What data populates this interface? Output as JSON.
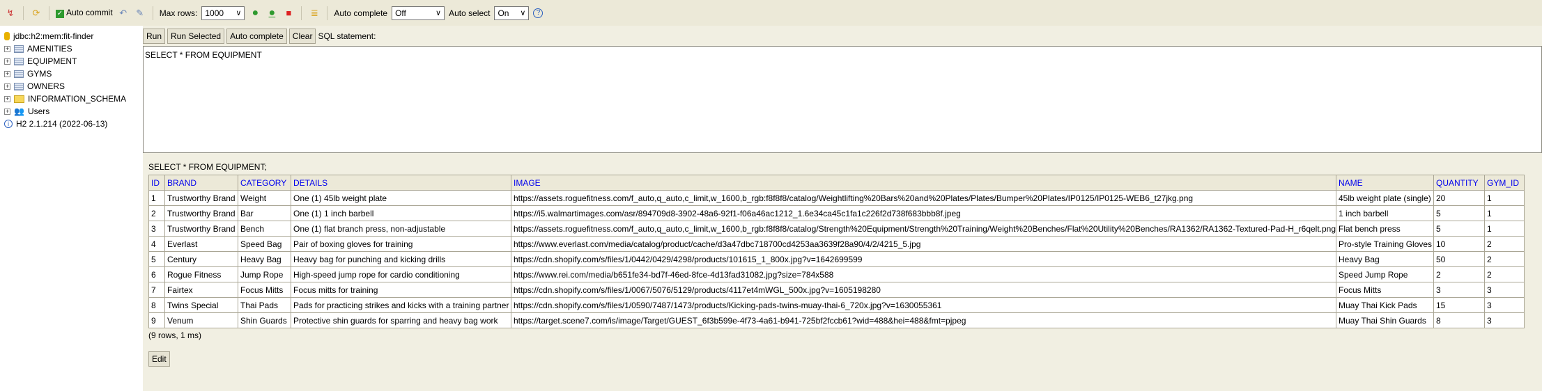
{
  "toolbar": {
    "auto_commit": "Auto commit",
    "max_rows_label": "Max rows:",
    "max_rows": "1000",
    "auto_complete_label": "Auto complete",
    "auto_complete": "Off",
    "auto_select_label": "Auto select",
    "auto_select": "On"
  },
  "sidebar": {
    "connection": "jdbc:h2:mem:fit-finder",
    "items": [
      {
        "label": "AMENITIES",
        "type": "table"
      },
      {
        "label": "EQUIPMENT",
        "type": "table"
      },
      {
        "label": "GYMS",
        "type": "table"
      },
      {
        "label": "OWNERS",
        "type": "table"
      },
      {
        "label": "INFORMATION_SCHEMA",
        "type": "folder"
      },
      {
        "label": "Users",
        "type": "users"
      }
    ],
    "version": "H2 2.1.214 (2022-06-13)"
  },
  "editor": {
    "run": "Run",
    "run_selected": "Run Selected",
    "auto_complete": "Auto complete",
    "clear": "Clear",
    "sql_label": "SQL statement:",
    "sql": "SELECT * FROM EQUIPMENT"
  },
  "results": {
    "query": "SELECT * FROM EQUIPMENT;",
    "columns": [
      "ID",
      "BRAND",
      "CATEGORY",
      "DETAILS",
      "IMAGE",
      "NAME",
      "QUANTITY",
      "GYM_ID"
    ],
    "rows": [
      [
        "1",
        "Trustworthy Brand",
        "Weight",
        "One (1) 45lb weight plate",
        "https://assets.roguefitness.com/f_auto,q_auto,c_limit,w_1600,b_rgb:f8f8f8/catalog/Weightlifting%20Bars%20and%20Plates/Plates/Bumper%20Plates/IP0125/IP0125-WEB6_t27jkg.png",
        "45lb weight plate (single)",
        "20",
        "1"
      ],
      [
        "2",
        "Trustworthy Brand",
        "Bar",
        "One (1) 1 inch barbell",
        "https://i5.walmartimages.com/asr/894709d8-3902-48a6-92f1-f06a46ac1212_1.6e34ca45c1fa1c226f2d738f683bbb8f.jpeg",
        "1 inch barbell",
        "5",
        "1"
      ],
      [
        "3",
        "Trustworthy Brand",
        "Bench",
        "One (1) flat branch press, non-adjustable",
        "https://assets.roguefitness.com/f_auto,q_auto,c_limit,w_1600,b_rgb:f8f8f8/catalog/Strength%20Equipment/Strength%20Training/Weight%20Benches/Flat%20Utility%20Benches/RA1362/RA1362-Textured-Pad-H_r6qelt.png",
        "Flat bench press",
        "5",
        "1"
      ],
      [
        "4",
        "Everlast",
        "Speed Bag",
        "Pair of boxing gloves for training",
        "https://www.everlast.com/media/catalog/product/cache/d3a47dbc718700cd4253aa3639f28a90/4/2/4215_5.jpg",
        "Pro-style Training Gloves",
        "10",
        "2"
      ],
      [
        "5",
        "Century",
        "Heavy Bag",
        "Heavy bag for punching and kicking drills",
        "https://cdn.shopify.com/s/files/1/0442/0429/4298/products/101615_1_800x.jpg?v=1642699599",
        "Heavy Bag",
        "50",
        "2"
      ],
      [
        "6",
        "Rogue Fitness",
        "Jump Rope",
        "High-speed jump rope for cardio conditioning",
        "https://www.rei.com/media/b651fe34-bd7f-46ed-8fce-4d13fad31082.jpg?size=784x588",
        "Speed Jump Rope",
        "2",
        "2"
      ],
      [
        "7",
        "Fairtex",
        "Focus Mitts",
        "Focus mitts for training",
        "https://cdn.shopify.com/s/files/1/0067/5076/5129/products/4117et4mWGL_500x.jpg?v=1605198280",
        "Focus Mitts",
        "3",
        "3"
      ],
      [
        "8",
        "Twins Special",
        "Thai Pads",
        "Pads for practicing strikes and kicks with a training partner",
        "https://cdn.shopify.com/s/files/1/0590/7487/1473/products/Kicking-pads-twins-muay-thai-6_720x.jpg?v=1630055361",
        "Muay Thai Kick Pads",
        "15",
        "3"
      ],
      [
        "9",
        "Venum",
        "Shin Guards",
        "Protective shin guards for sparring and heavy bag work",
        "https://target.scene7.com/is/image/Target/GUEST_6f3b599e-4f73-4a61-b941-725bf2fccb61?wid=488&hei=488&fmt=pjpeg",
        "Muay Thai Shin Guards",
        "8",
        "3"
      ]
    ],
    "status": "(9 rows, 1 ms)",
    "edit": "Edit"
  }
}
